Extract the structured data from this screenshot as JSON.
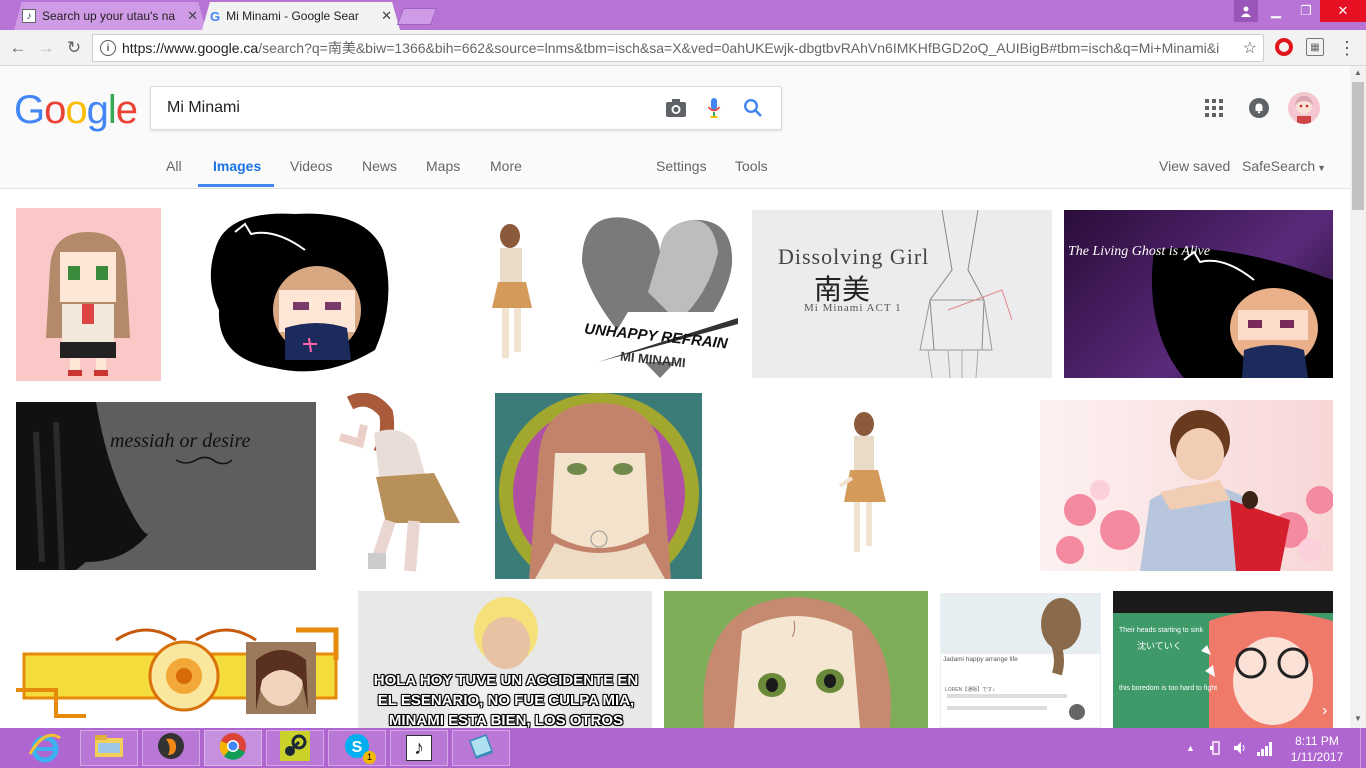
{
  "browser": {
    "tabs": [
      {
        "label": "Search up your utau's na"
      },
      {
        "label": "Mi Minami - Google Sear"
      }
    ],
    "url_scheme_host": "https://www.google.ca",
    "url_rest": "/search?q=南美&biw=1366&bih=662&source=lnms&tbm=isch&sa=X&ved=0ahUKEwjk-dbgtbvRAhVn6IMKHfBGD2oQ_AUIBigB#tbm=isch&q=Mi+Minami&i",
    "info_glyph": "i"
  },
  "google": {
    "logo": [
      "G",
      "o",
      "o",
      "g",
      "l",
      "e"
    ],
    "logo_colors": [
      "#4285f4",
      "#ea4335",
      "#fbbc05",
      "#4285f4",
      "#34a853",
      "#ea4335"
    ],
    "query": "Mi Minami",
    "nav": {
      "all": "All",
      "images": "Images",
      "videos": "Videos",
      "news": "News",
      "maps": "Maps",
      "more": "More",
      "settings": "Settings",
      "tools": "Tools",
      "view_saved": "View saved",
      "safesearch": "SafeSearch"
    }
  },
  "results": {
    "dissolving_title": "Dissolving Girl",
    "dissolving_kanji": "南美",
    "dissolving_sub": "Mi Minami ACT 1",
    "living_ghost": "The Living Ghost is Alive",
    "unhappy": "UNHAPPY REFRAIN",
    "mi_minami": "MI MINAMI",
    "messiah": "messiah or desire",
    "meme_text": "HOLA HOY TUVE UN ACCIDENTE EN EL ESENARIO, NO FUE CULPA MIA, MINAMI ESTA BIEN, LOS OTROS CABROS TAMBIEN Y",
    "blog_title": "Jadami happy arrange life",
    "blog_sub": "LOREN【通販】です♪",
    "sink_text": "Their heads starting to sink",
    "sink_jp": "沈いていく",
    "boredom": "this boredom is too hard to fight"
  },
  "taskbar": {
    "time": "8:11 PM",
    "date": "1/11/2017",
    "skype_badge": "1"
  }
}
